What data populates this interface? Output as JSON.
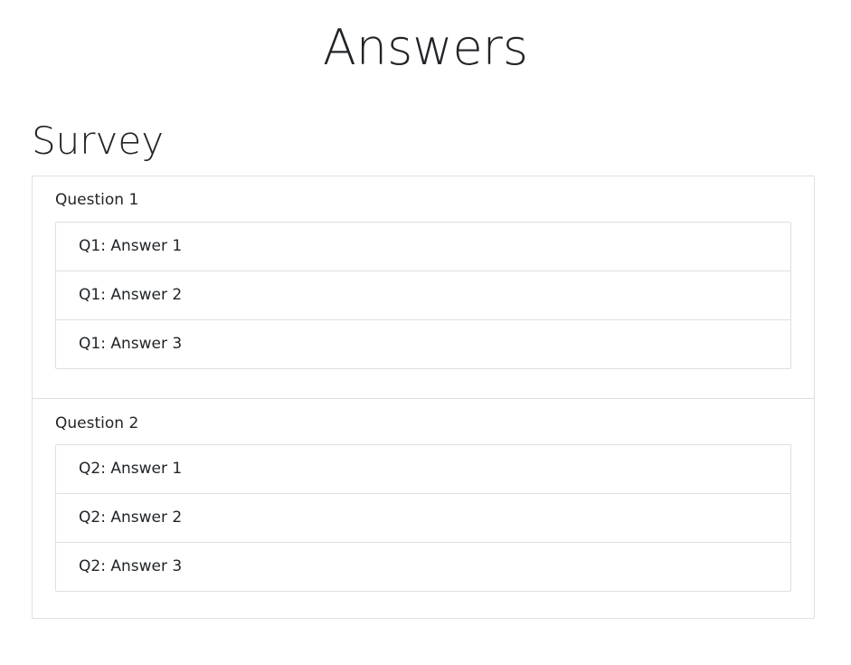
{
  "page": {
    "title": "Answers"
  },
  "survey": {
    "title": "Survey",
    "questions": [
      {
        "label": "Question 1",
        "answers": [
          "Q1: Answer 1",
          "Q1: Answer 2",
          "Q1: Answer 3"
        ]
      },
      {
        "label": "Question 2",
        "answers": [
          "Q2: Answer 1",
          "Q2: Answer 2",
          "Q2: Answer 3"
        ]
      }
    ]
  },
  "colors": {
    "text": "#212529",
    "border": "#dfdfdf",
    "background": "#ffffff"
  }
}
